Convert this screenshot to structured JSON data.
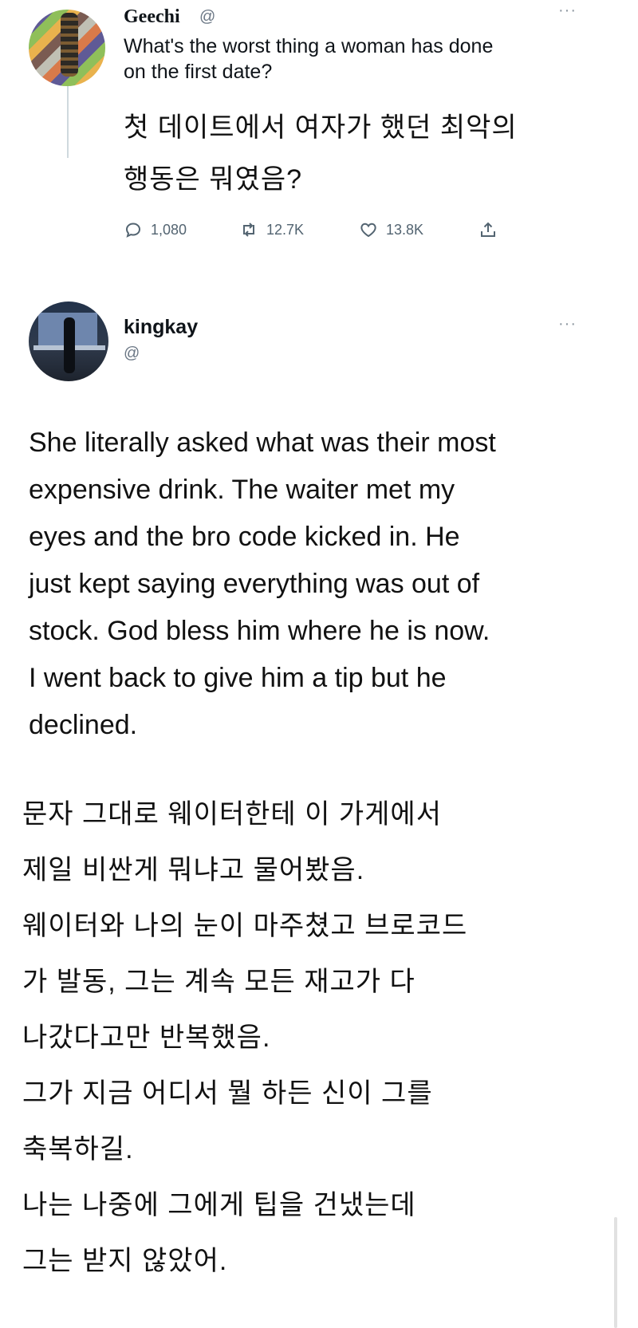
{
  "tweet1": {
    "name": "Geechi",
    "handle": "@",
    "more": "···",
    "text_en": [
      "What's the worst thing a woman has done",
      "on the first date?"
    ],
    "text_ko": [
      "첫 데이트에서 여자가 했던 최악의",
      "행동은 뭐였음?"
    ],
    "actions": {
      "reply_count": "1,080",
      "retweet_count": "12.7K",
      "like_count": "13.8K"
    }
  },
  "tweet2": {
    "name": "kingkay",
    "handle": "@",
    "more": "···",
    "text_en": [
      "She literally asked what was their most",
      "expensive drink. The waiter met my",
      "eyes and the bro code kicked in. He",
      "just kept saying everything was out of",
      "stock. God bless him where he is now.",
      "I went back to give him a tip but he",
      "declined."
    ],
    "text_ko": [
      "문자 그대로 웨이터한테 이 가게에서",
      "제일 비싼게 뭐냐고 물어봤음.",
      "웨이터와 나의 눈이 마주쳤고 브로코드",
      "가 발동, 그는 계속 모든 재고가 다",
      "나갔다고만 반복했음.",
      "그가 지금 어디서 뭘 하든 신이 그를",
      "축복하길.",
      "나는 나중에 그에게 팁을 건냈는데",
      "그는 받지 않았어."
    ]
  }
}
